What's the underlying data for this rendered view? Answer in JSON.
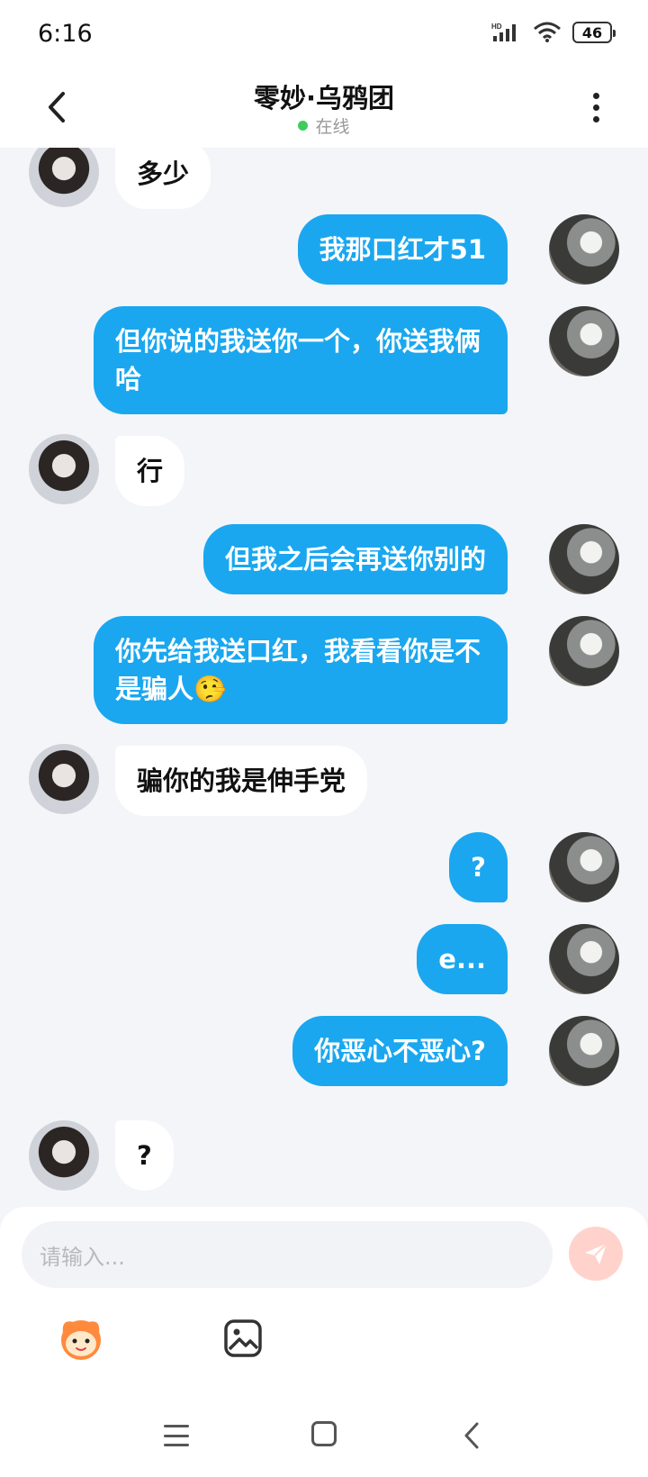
{
  "status_bar": {
    "time": "6:16",
    "battery": "46"
  },
  "header": {
    "title": "零妙·乌鸦团",
    "status": "在线"
  },
  "messages": [
    {
      "side": "them",
      "text": "多少"
    },
    {
      "side": "me",
      "text": "我那口红才51"
    },
    {
      "side": "me",
      "text": "但你说的我送你一个，你送我俩哈"
    },
    {
      "side": "them",
      "text": "行"
    },
    {
      "side": "me",
      "text": "但我之后会再送你别的"
    },
    {
      "side": "me",
      "text": "你先给我送口红，我看看你是不是骗人🤥"
    },
    {
      "side": "them",
      "text": "骗你的我是伸手党"
    },
    {
      "side": "me",
      "text": "?"
    },
    {
      "side": "me",
      "text": "e..."
    },
    {
      "side": "me",
      "text": "你恶心不恶心?"
    },
    {
      "side": "them",
      "text": "?"
    }
  ],
  "input": {
    "placeholder": "请输入..."
  },
  "colors": {
    "my_bubble": "#1aa7ef",
    "their_bubble": "#ffffff",
    "online": "#3dcc5c",
    "send_button": "#ffd3cc"
  },
  "icons": [
    "back-arrow-icon",
    "more-vertical-icon",
    "send-icon",
    "emoji-mascot-icon",
    "image-icon",
    "nav-menu-icon",
    "nav-home-icon",
    "nav-back-icon"
  ]
}
